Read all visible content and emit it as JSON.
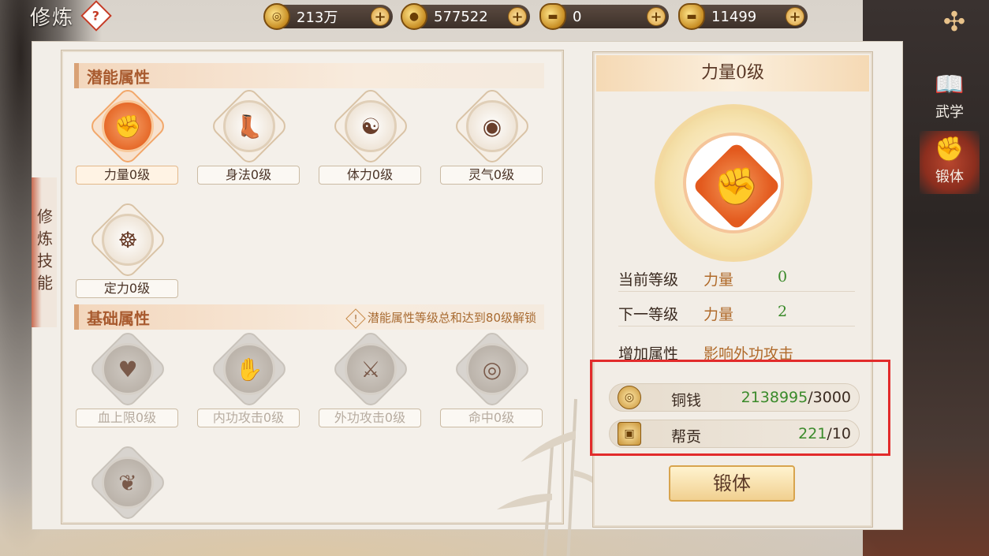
{
  "header": {
    "title": "修炼",
    "help_glyph": "?"
  },
  "currencies": [
    {
      "icon": "copper-coin-icon",
      "glyph": "◎",
      "value": "213万"
    },
    {
      "icon": "gold-coin-icon",
      "glyph": "●",
      "value": "577522"
    },
    {
      "icon": "bound-gold-ingot-icon",
      "glyph": "▬",
      "value": "0"
    },
    {
      "icon": "gold-ingot-icon",
      "glyph": "▬",
      "value": "11499"
    }
  ],
  "side_tab": {
    "label": "修炼技能"
  },
  "potential": {
    "title": "潜能属性",
    "items": [
      {
        "label": "力量0级",
        "glyph": "✊",
        "state": "active"
      },
      {
        "label": "身法0级",
        "glyph": "👢",
        "state": "normal"
      },
      {
        "label": "体力0级",
        "glyph": "☯",
        "state": "normal"
      },
      {
        "label": "灵气0级",
        "glyph": "◉",
        "state": "normal"
      },
      {
        "label": "定力0级",
        "glyph": "☸",
        "state": "normal"
      }
    ]
  },
  "basic": {
    "title": "基础属性",
    "lock_note": "潜能属性等级总和达到80级解锁",
    "items": [
      {
        "label": "血上限0级",
        "glyph": "♥",
        "state": "locked"
      },
      {
        "label": "内功攻击0级",
        "glyph": "✋",
        "state": "locked"
      },
      {
        "label": "外功攻击0级",
        "glyph": "⚔",
        "state": "locked"
      },
      {
        "label": "命中0级",
        "glyph": "◎",
        "state": "locked"
      },
      {
        "label": "",
        "glyph": "❦",
        "state": "locked"
      }
    ]
  },
  "detail": {
    "title": "力量0级",
    "emblem_glyph": "✊",
    "rows": [
      {
        "key": "当前等级",
        "attr": "力量",
        "value": "0"
      },
      {
        "key": "下一等级",
        "attr": "力量",
        "value": "2"
      },
      {
        "key": "增加属性",
        "attr": "影响外功攻击",
        "value": ""
      }
    ],
    "costs": [
      {
        "name": "铜钱",
        "have": "2138995",
        "need": "/3000",
        "icon": "copper-coin-icon",
        "glyph": "◎"
      },
      {
        "name": "帮贡",
        "have": "221",
        "need": "/10",
        "icon": "guild-token-icon",
        "glyph": "▣"
      }
    ],
    "action_label": "锻体"
  },
  "nav": [
    {
      "label": "武学",
      "glyph": "📖",
      "active": false
    },
    {
      "label": "锻体",
      "glyph": "✊",
      "active": true
    }
  ],
  "colors": {
    "accent_orange": "#e66a2a",
    "green_value": "#3a8a2a",
    "highlight_red": "#e22b2b"
  }
}
